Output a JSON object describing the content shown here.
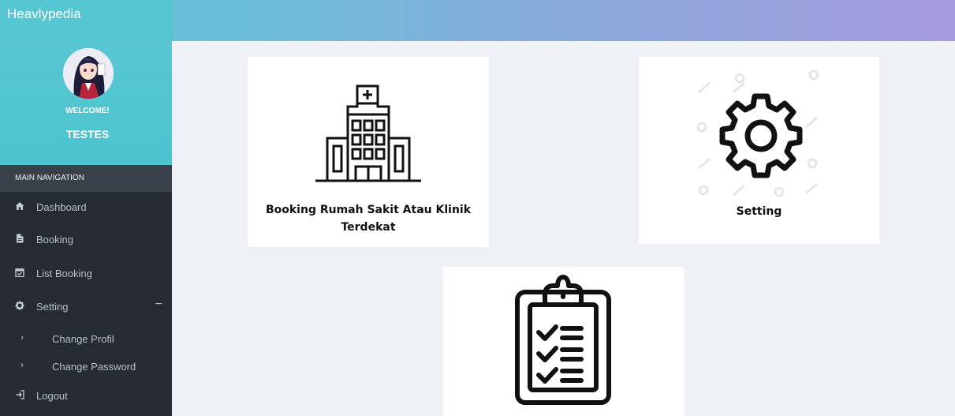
{
  "app": {
    "title": "Heavlypedia"
  },
  "user": {
    "welcome": "WELCOME!",
    "name": "TESTES"
  },
  "nav": {
    "header": "MAIN NAVIGATION",
    "items": [
      {
        "label": "Dashboard",
        "icon": "home-icon"
      },
      {
        "label": "Booking",
        "icon": "file-icon"
      },
      {
        "label": "List Booking",
        "icon": "calendar-check-icon"
      },
      {
        "label": "Setting",
        "icon": "cog-icon",
        "expanded": true,
        "toggle": "−"
      }
    ],
    "sub_items": [
      {
        "label": "Change Profil"
      },
      {
        "label": "Change Password"
      }
    ],
    "logout": {
      "label": "Logout",
      "icon": "sign-out-icon"
    },
    "chevron": "›"
  },
  "cards": [
    {
      "label": "Booking Rumah Sakit Atau Klinik Terdekat",
      "icon": "hospital-icon"
    },
    {
      "label": "Setting",
      "icon": "gear-icon"
    },
    {
      "label": "",
      "icon": "clipboard-checklist-icon"
    }
  ],
  "colors": {
    "header_start": "#5bc8d6",
    "header_end": "#a79be0",
    "sidebar": "#262b33",
    "content_bg": "#edf1f5"
  }
}
